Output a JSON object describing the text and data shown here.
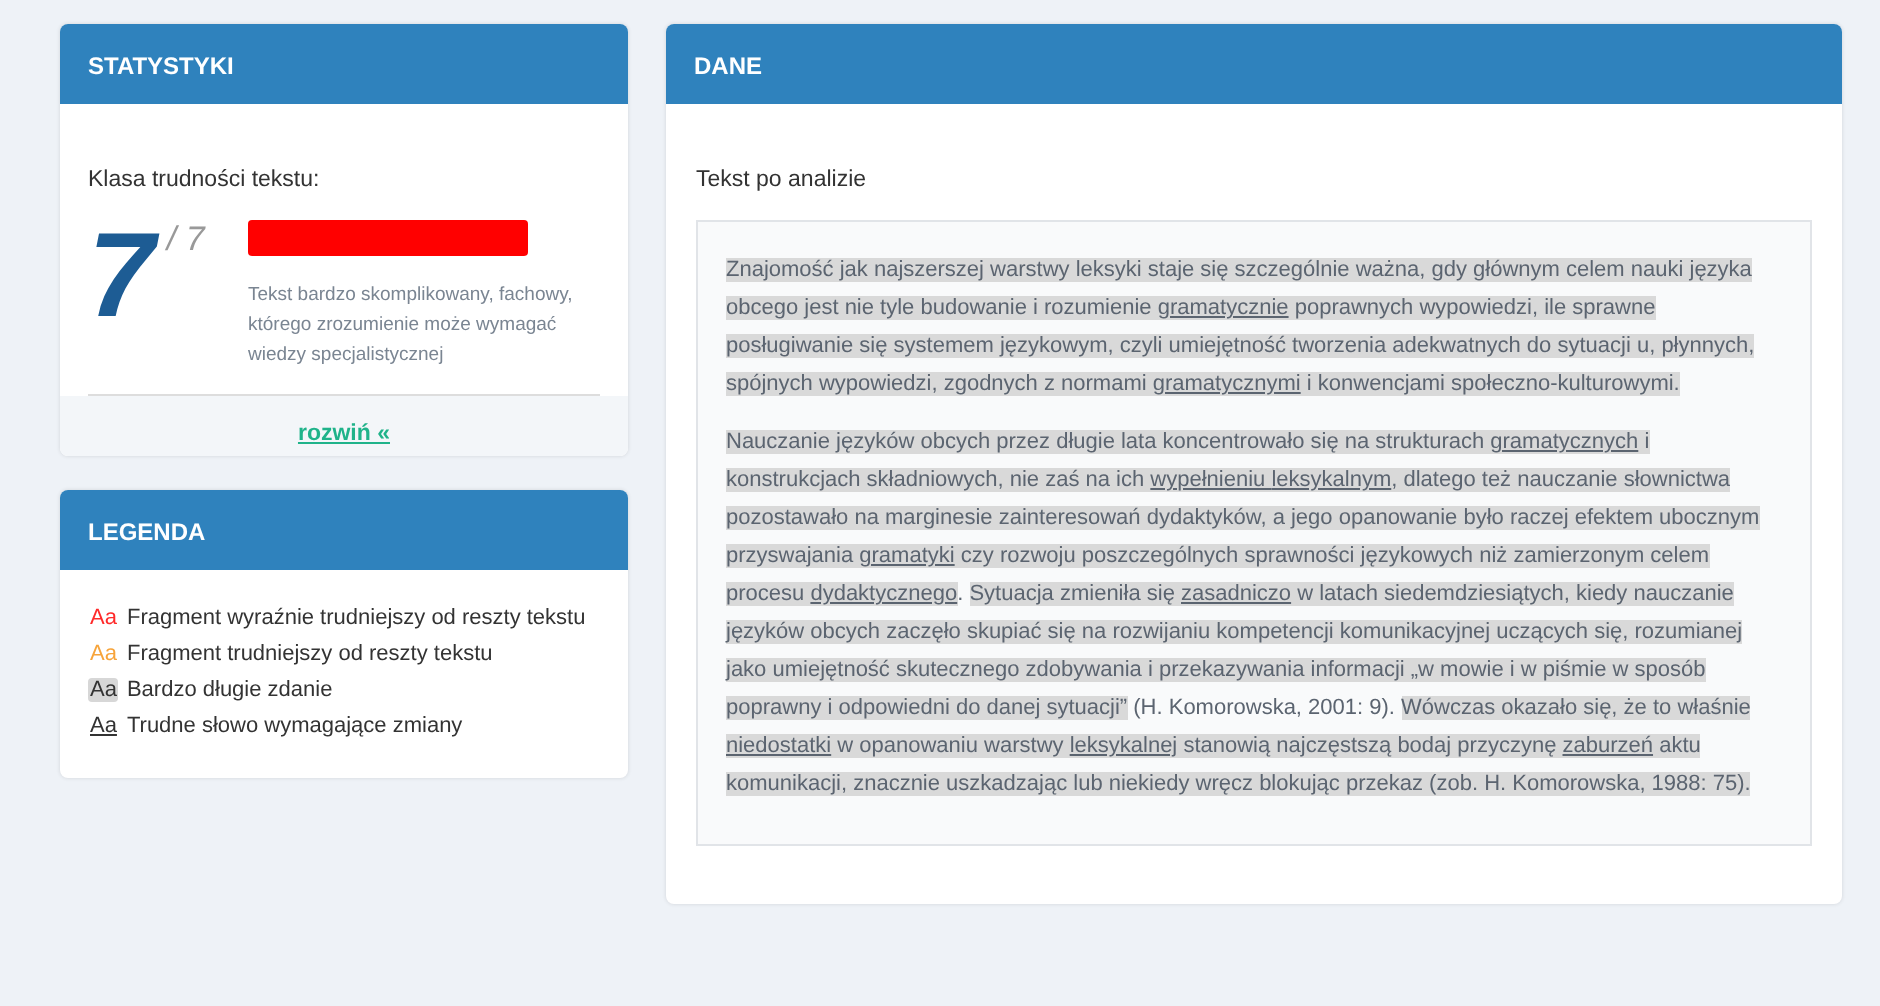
{
  "stats": {
    "title": "STATYSTYKI",
    "label": "Klasa trudności tekstu:",
    "score": "7",
    "max": "/ 7",
    "level": 1,
    "description": "Tekst bardzo skomplikowany, fachowy, którego zrozumienie może wymagać wiedzy specjalistycznej",
    "expand_link": "rozwiń «"
  },
  "legend": {
    "title": "LEGENDA",
    "items": [
      {
        "kind": "very_hard",
        "sample": "Aa",
        "label": "Fragment wyraźnie trudniejszy od reszty tekstu"
      },
      {
        "kind": "hard",
        "sample": "Aa",
        "label": "Fragment trudniejszy od reszty tekstu"
      },
      {
        "kind": "long_sentence",
        "sample": "Aa",
        "label": "Bardzo długie zdanie"
      },
      {
        "kind": "hard_word",
        "sample": "Aa",
        "label": "Trudne słowo wymagające zmiany"
      }
    ]
  },
  "data": {
    "title": "DANE",
    "label": "Tekst po analizie",
    "paragraphs": [
      {
        "sentences": [
          {
            "long": true,
            "parts": [
              {
                "text": "Znajomość jak najszerszej warstwy leksyki staje się szczególnie ważna, gdy głównym celem nauki języka obcego jest nie tyle budowanie i rozumienie ",
                "hard": false
              },
              {
                "text": "gramatycznie",
                "hard": true
              },
              {
                "text": " poprawnych wypowiedzi, ile sprawne posługiwanie się systemem językowym, czyli umiejętność tworzenia adekwatnych do sytuacji u, płynnych, spójnych wypowiedzi, zgodnych z normami ",
                "hard": false
              },
              {
                "text": "gramatycznymi",
                "hard": true
              },
              {
                "text": " i konwencjami społeczno-kulturowymi.",
                "hard": false
              }
            ]
          }
        ]
      },
      {
        "sentences": [
          {
            "long": true,
            "parts": [
              {
                "text": "Nauczanie języków obcych przez długie lata koncentrowało się na strukturach ",
                "hard": false
              },
              {
                "text": "gramatycznych",
                "hard": true
              },
              {
                "text": " i konstrukcjach składniowych, nie zaś na ich ",
                "hard": false
              },
              {
                "text": "wypełnieniu ",
                "hard": true
              },
              {
                "text": "leksykalnym",
                "hard": true
              },
              {
                "text": ", dlatego też nauczanie słownictwa pozostawało na marginesie zainteresowań dydaktyków, a jego opanowanie było raczej efektem ubocznym przyswajania ",
                "hard": false
              },
              {
                "text": "gramatyki",
                "hard": true
              },
              {
                "text": " czy rozwoju poszczególnych sprawności językowych niż zamierzonym celem procesu ",
                "hard": false
              },
              {
                "text": "dydaktycznego",
                "hard": true
              }
            ]
          },
          {
            "long": false,
            "parts": [
              {
                "text": ". ",
                "hard": false
              }
            ]
          },
          {
            "long": true,
            "parts": [
              {
                "text": "Sytuacja zmieniła się ",
                "hard": false
              },
              {
                "text": "zasadniczo",
                "hard": true
              },
              {
                "text": " w latach siedemdziesiątych, kiedy nauczanie języków obcych zaczęło skupiać się na rozwijaniu kompetencji komunikacyjnej uczących się, rozumianej jako umiejętność skutecznego zdobywania i przekazywania informacji „w mowie i w piśmie w sposób poprawny i odpowiedni do danej sytuacji”",
                "hard": false
              }
            ]
          },
          {
            "long": false,
            "parts": [
              {
                "text": " (H. Komorowska, 2001: 9). ",
                "hard": false
              }
            ]
          },
          {
            "long": true,
            "parts": [
              {
                "text": "Wówczas okazało się, że to właśnie ",
                "hard": false
              },
              {
                "text": "niedostatki",
                "hard": true
              },
              {
                "text": " w opanowaniu warstwy ",
                "hard": false
              },
              {
                "text": "leksykalnej",
                "hard": true
              },
              {
                "text": " stanowią najczęstszą bodaj przyczynę ",
                "hard": false
              },
              {
                "text": "zaburzeń",
                "hard": true
              },
              {
                "text": " aktu komunikacji, znacznie uszkadzając lub niekiedy wręcz blokując przekaz (zob. H. Komorowska, 1988: 75).",
                "hard": false
              }
            ]
          }
        ]
      }
    ]
  }
}
